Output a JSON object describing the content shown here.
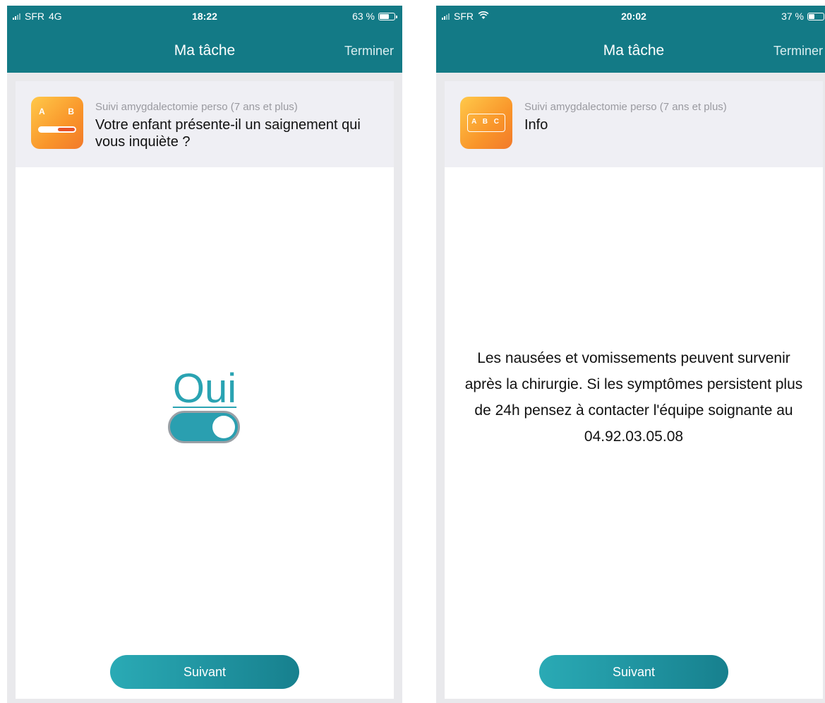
{
  "left_screen": {
    "status": {
      "carrier": "SFR",
      "network": "4G",
      "time": "18:22",
      "battery": "63 %",
      "battery_level_pct": 63
    },
    "nav": {
      "title": "Ma tâche",
      "done_label": "Terminer"
    },
    "header": {
      "icon": "slider-scale-icon",
      "icon_letters": [
        "A",
        "B"
      ],
      "survey_name": "Suivi amygdalectomie perso (7 ans et plus)",
      "question": "Votre enfant présente-il un saignement qui vous inquiète ?"
    },
    "answer": {
      "label": "Oui",
      "toggle_on": true
    },
    "next_label": "Suivant"
  },
  "right_screen": {
    "status": {
      "carrier": "SFR",
      "network": "wifi-icon",
      "time": "20:02",
      "battery": "37 %",
      "battery_level_pct": 37
    },
    "nav": {
      "title": "Ma tâche",
      "done_label": "Terminer"
    },
    "header": {
      "icon": "text-abc-icon",
      "icon_letters": "A B C",
      "survey_name": "Suivi amygdalectomie perso (7 ans et plus)",
      "question": "Info"
    },
    "info_text": "Les nausées et vomissements peuvent survenir après la chirurgie. Si les symptômes persistent plus de 24h pensez à contacter l'équipe soignante au 04.92.03.05.08",
    "next_label": "Suivant"
  },
  "colors": {
    "brand_teal": "#137a86",
    "accent_teal": "#2aa3b2",
    "icon_orange": "#f9952a"
  }
}
